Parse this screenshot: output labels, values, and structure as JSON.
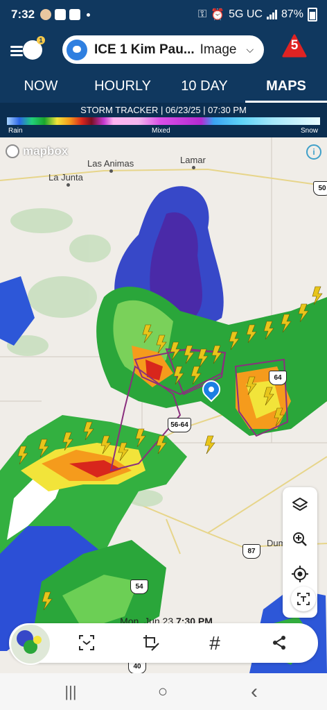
{
  "status_bar": {
    "time": "7:32",
    "network": "5G UC",
    "battery": "87%"
  },
  "app_bar": {
    "menu_badge": "1",
    "location_name": "ICE 1 Kim Pau...",
    "location_type": "Image",
    "alert_count": "5"
  },
  "tabs": [
    {
      "label": "NOW"
    },
    {
      "label": "HOURLY"
    },
    {
      "label": "10 DAY"
    },
    {
      "label": "MAPS"
    }
  ],
  "legend": {
    "title": "STORM TRACKER | 06/23/25 | 07:30 PM",
    "rain": "Rain",
    "mixed": "Mixed",
    "snow": "Snow"
  },
  "map": {
    "attribution": "mapbox",
    "info": "i",
    "cities": [
      {
        "name": "Las Animas"
      },
      {
        "name": "Lamar"
      },
      {
        "name": "La Junta"
      },
      {
        "name": "Dumas"
      }
    ],
    "shields": [
      "50",
      "56-64",
      "64",
      "87",
      "54",
      "40"
    ]
  },
  "map_controls": {
    "layers_icon": "layers-icon",
    "zoom_icon": "zoom-in-icon",
    "locate_icon": "my-location-icon",
    "scan_icon": "text-scan-icon"
  },
  "timestamp": {
    "date": "Mon, Jun 23",
    "time": "7:30 PM"
  },
  "toolbar": {
    "select_icon": "select-icon",
    "edit_icon": "crop-edit-icon",
    "hashtag_icon": "hashtag-icon",
    "share_icon": "share-icon"
  },
  "nav_bar": {
    "recents": "|||",
    "home": "○",
    "back": "‹"
  }
}
